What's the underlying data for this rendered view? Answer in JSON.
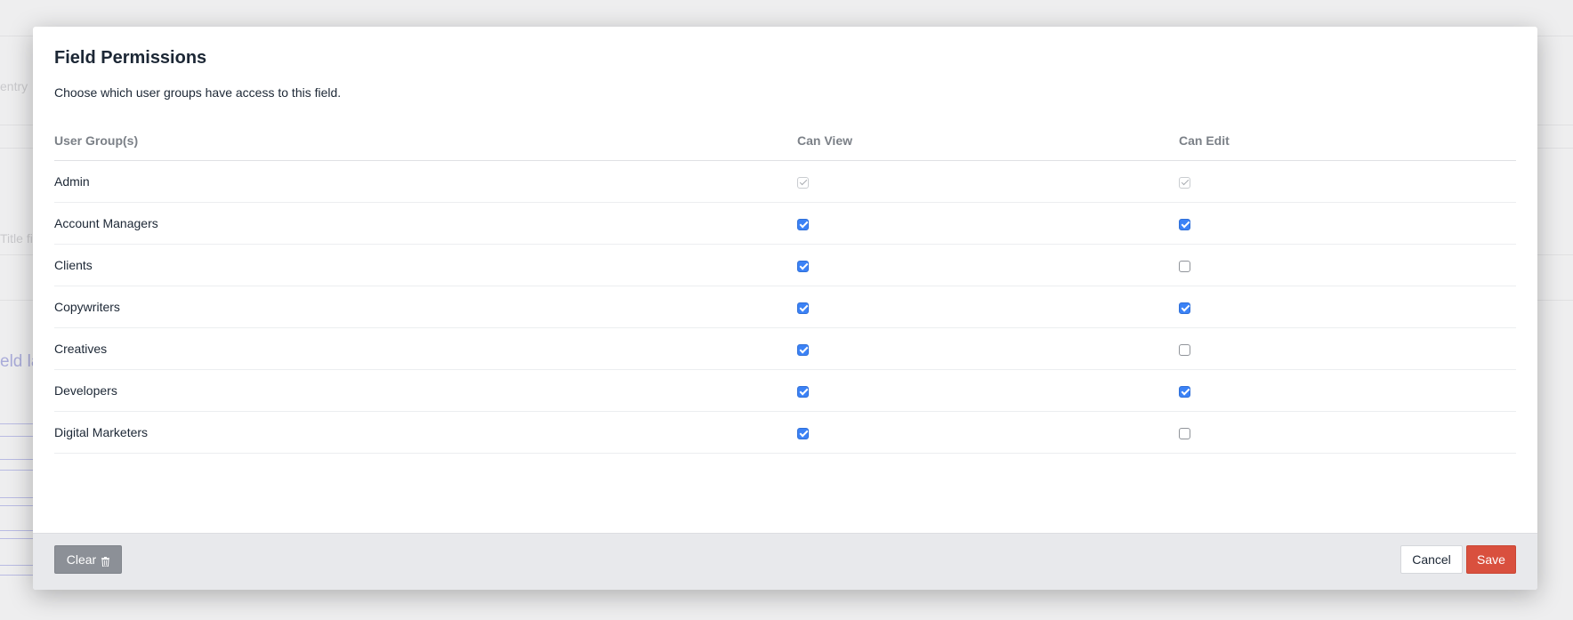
{
  "background": {
    "faded_texts": [
      "entry",
      "Title fi"
    ],
    "faded_link": "eld la"
  },
  "modal": {
    "title": "Field Permissions",
    "description": "Choose which user groups have access to this field.",
    "columns": {
      "group": "User Group(s)",
      "view": "Can View",
      "edit": "Can Edit"
    },
    "rows": [
      {
        "name": "Admin",
        "can_view": "checked-disabled",
        "can_edit": "checked-disabled"
      },
      {
        "name": "Account Managers",
        "can_view": "checked",
        "can_edit": "checked"
      },
      {
        "name": "Clients",
        "can_view": "checked",
        "can_edit": "unchecked"
      },
      {
        "name": "Copywriters",
        "can_view": "checked",
        "can_edit": "checked"
      },
      {
        "name": "Creatives",
        "can_view": "checked",
        "can_edit": "unchecked"
      },
      {
        "name": "Developers",
        "can_view": "checked",
        "can_edit": "checked"
      },
      {
        "name": "Digital Marketers",
        "can_view": "checked",
        "can_edit": "unchecked"
      }
    ],
    "footer": {
      "clear_label": "Clear",
      "clear_icon": "trash-icon",
      "cancel_label": "Cancel",
      "save_label": "Save"
    }
  },
  "colors": {
    "checkbox_accent": "#3b82f6",
    "save_button": "#d9503e",
    "clear_button": "#8c9097",
    "footer_bg": "#e8e9ec"
  }
}
